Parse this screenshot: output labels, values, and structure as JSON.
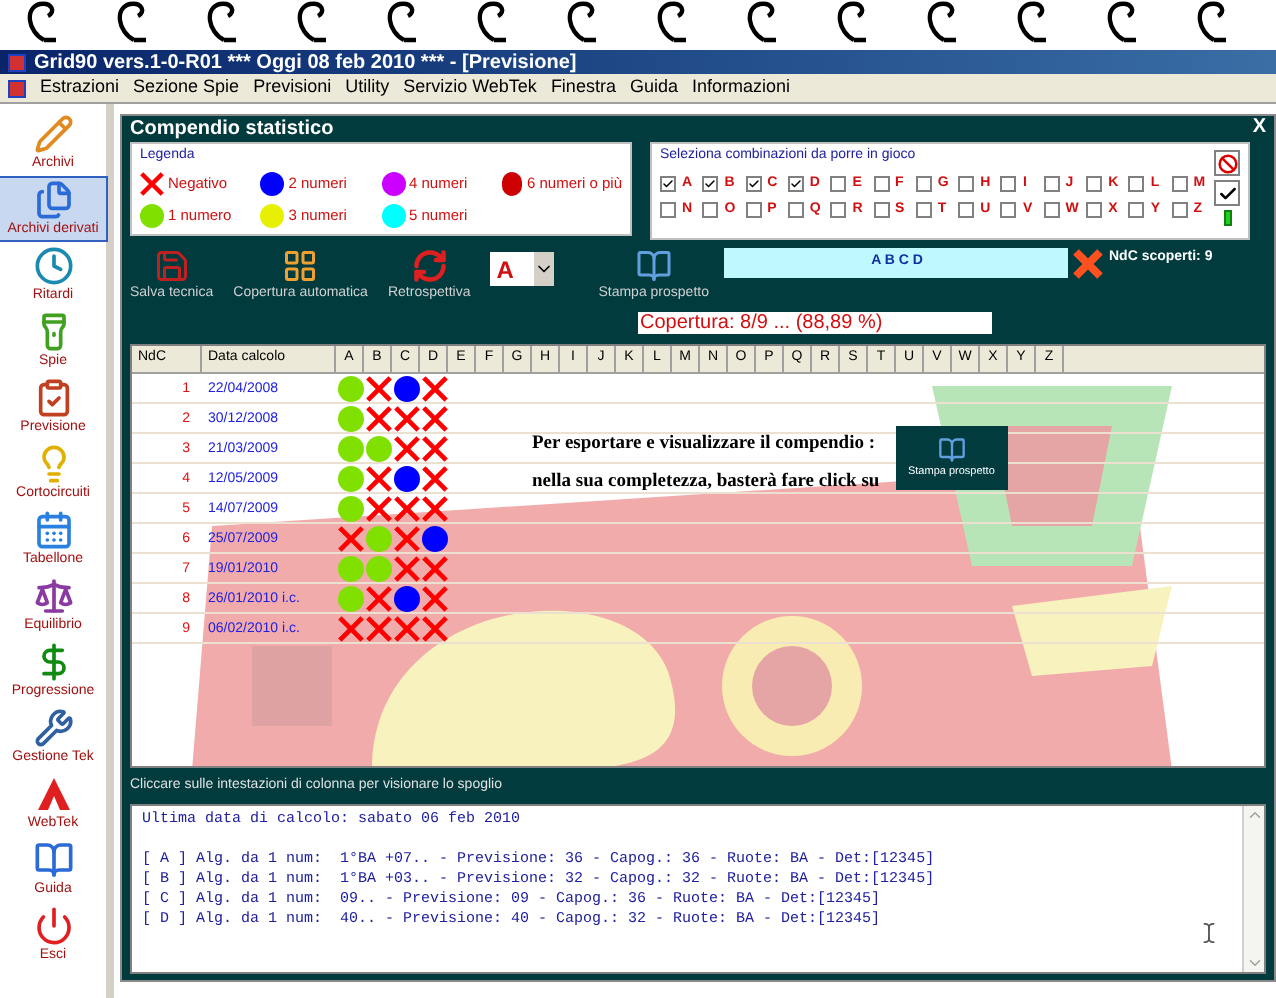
{
  "window": {
    "title": "Grid90 vers.1-0-R01  ***  Oggi 08 feb 2010  ***   - [Previsione]"
  },
  "menu": [
    "Estrazioni",
    "Sezione Spie",
    "Previsioni",
    "Utility",
    "Servizio WebTek",
    "Finestra",
    "Guida",
    "Informazioni"
  ],
  "sidebar": {
    "items": [
      {
        "label": "Archivi",
        "selected": false
      },
      {
        "label": "Archivi derivati",
        "selected": true
      },
      {
        "label": "Ritardi",
        "selected": false
      },
      {
        "label": "Spie",
        "selected": false
      },
      {
        "label": "Previsione",
        "selected": false
      },
      {
        "label": "Cortocircuiti",
        "selected": false
      },
      {
        "label": "Tabellone",
        "selected": false
      },
      {
        "label": "Equilibrio",
        "selected": false
      },
      {
        "label": "Progressione",
        "selected": false
      },
      {
        "label": "Gestione Tek",
        "selected": false
      },
      {
        "label": "WebTek",
        "selected": false
      },
      {
        "label": "Guida",
        "selected": false
      },
      {
        "label": "Esci",
        "selected": false
      }
    ]
  },
  "panel": {
    "title": "Compendio statistico",
    "close": "X",
    "legend": {
      "title": "Legenda",
      "items": [
        {
          "kind": "cross",
          "label": "Negativo"
        },
        {
          "kind": "dot",
          "color": "#0000ff",
          "label": "2 numeri"
        },
        {
          "kind": "dot",
          "color": "#cc00ff",
          "label": "4 numeri"
        },
        {
          "kind": "dot",
          "color": "#cc0000",
          "label": "6 numeri o più"
        },
        {
          "kind": "dot",
          "color": "#80e000",
          "label": "1 numero"
        },
        {
          "kind": "dot",
          "color": "#e6f000",
          "label": "3 numeri"
        },
        {
          "kind": "dot",
          "color": "#00ffff",
          "label": "5 numeri"
        }
      ]
    },
    "selection": {
      "title": "Seleziona combinazioni da porre in gioco",
      "options": [
        {
          "label": "A",
          "checked": true
        },
        {
          "label": "B",
          "checked": true
        },
        {
          "label": "C",
          "checked": true
        },
        {
          "label": "D",
          "checked": true
        },
        {
          "label": "E",
          "checked": false
        },
        {
          "label": "F",
          "checked": false
        },
        {
          "label": "G",
          "checked": false
        },
        {
          "label": "H",
          "checked": false
        },
        {
          "label": "I",
          "checked": false
        },
        {
          "label": "J",
          "checked": false
        },
        {
          "label": "K",
          "checked": false
        },
        {
          "label": "L",
          "checked": false
        },
        {
          "label": "M",
          "checked": false
        },
        {
          "label": "N",
          "checked": false
        },
        {
          "label": "O",
          "checked": false
        },
        {
          "label": "P",
          "checked": false
        },
        {
          "label": "Q",
          "checked": false
        },
        {
          "label": "R",
          "checked": false
        },
        {
          "label": "S",
          "checked": false
        },
        {
          "label": "T",
          "checked": false
        },
        {
          "label": "U",
          "checked": false
        },
        {
          "label": "V",
          "checked": false
        },
        {
          "label": "W",
          "checked": false
        },
        {
          "label": "X",
          "checked": false
        },
        {
          "label": "Y",
          "checked": false
        },
        {
          "label": "Z",
          "checked": false
        }
      ]
    },
    "toolbar": {
      "buttons": [
        "Salva tecnica",
        "Copertura automatica",
        "Retrospettiva"
      ],
      "dropdown": "A",
      "print": "Stampa prospetto"
    },
    "combination": "A B C D",
    "uncovered": "NdC scoperti: 9",
    "coverage": "Copertura: 8/9 ... (88,89 %)",
    "table": {
      "columns": [
        "NdC",
        "Data calcolo",
        "A",
        "B",
        "C",
        "D",
        "E",
        "F",
        "G",
        "H",
        "I",
        "J",
        "K",
        "L",
        "M",
        "N",
        "O",
        "P",
        "Q",
        "R",
        "S",
        "T",
        "U",
        "V",
        "W",
        "X",
        "Y",
        "Z"
      ],
      "rows": [
        {
          "ndc": "1",
          "date": "22/04/2008",
          "cells": [
            {
              "kind": "dot",
              "color": "#80e000"
            },
            {
              "kind": "cross"
            },
            {
              "kind": "dot",
              "color": "#0000ff"
            },
            {
              "kind": "cross"
            }
          ]
        },
        {
          "ndc": "2",
          "date": "30/12/2008",
          "cells": [
            {
              "kind": "dot",
              "color": "#80e000"
            },
            {
              "kind": "cross"
            },
            {
              "kind": "cross"
            },
            {
              "kind": "cross"
            }
          ]
        },
        {
          "ndc": "3",
          "date": "21/03/2009",
          "cells": [
            {
              "kind": "dot",
              "color": "#80e000"
            },
            {
              "kind": "dot",
              "color": "#80e000"
            },
            {
              "kind": "cross"
            },
            {
              "kind": "cross"
            }
          ]
        },
        {
          "ndc": "4",
          "date": "12/05/2009",
          "cells": [
            {
              "kind": "dot",
              "color": "#80e000"
            },
            {
              "kind": "cross"
            },
            {
              "kind": "dot",
              "color": "#0000ff"
            },
            {
              "kind": "cross"
            }
          ]
        },
        {
          "ndc": "5",
          "date": "14/07/2009",
          "cells": [
            {
              "kind": "dot",
              "color": "#80e000"
            },
            {
              "kind": "cross"
            },
            {
              "kind": "cross"
            },
            {
              "kind": "cross"
            }
          ]
        },
        {
          "ndc": "6",
          "date": "25/07/2009",
          "cells": [
            {
              "kind": "cross"
            },
            {
              "kind": "dot",
              "color": "#80e000"
            },
            {
              "kind": "cross"
            },
            {
              "kind": "dot",
              "color": "#0000ff"
            }
          ]
        },
        {
          "ndc": "7",
          "date": "19/01/2010",
          "cells": [
            {
              "kind": "dot",
              "color": "#80e000"
            },
            {
              "kind": "dot",
              "color": "#80e000"
            },
            {
              "kind": "cross"
            },
            {
              "kind": "cross"
            }
          ]
        },
        {
          "ndc": "8",
          "date": "26/01/2010 i.c.",
          "cells": [
            {
              "kind": "dot",
              "color": "#80e000"
            },
            {
              "kind": "cross"
            },
            {
              "kind": "dot",
              "color": "#0000ff"
            },
            {
              "kind": "cross"
            }
          ]
        },
        {
          "ndc": "9",
          "date": "06/02/2010 i.c.",
          "cells": [
            {
              "kind": "cross"
            },
            {
              "kind": "cross"
            },
            {
              "kind": "cross"
            },
            {
              "kind": "cross"
            }
          ]
        }
      ]
    },
    "note": {
      "lines": [
        "Per esportare e visualizzare il compendio :",
        "nella sua completezza, basterà fare click su"
      ],
      "button": "Stampa prospetto"
    },
    "hint": "Cliccare sulle intestazioni di colonna per visionare lo spoglio",
    "output": {
      "heading": "Ultima data di calcolo: sabato 06 feb 2010",
      "lines": [
        "[ A ] Alg. da 1 num:  1°BA +07.. - Previsione: 36 - Capog.: 36 - Ruote: BA - Det:[12345]",
        "[ B ] Alg. da 1 num:  1°BA +03.. - Previsione: 32 - Capog.: 32 - Ruote: BA - Det:[12345]",
        "[ C ] Alg. da 1 num:  09.. - Previsione: 09 - Capog.: 36 - Ruote: BA - Det:[12345]",
        "[ D ] Alg. da 1 num:  40.. - Previsione: 40 - Capog.: 32 - Ruote: BA - Det:[12345]"
      ]
    }
  }
}
